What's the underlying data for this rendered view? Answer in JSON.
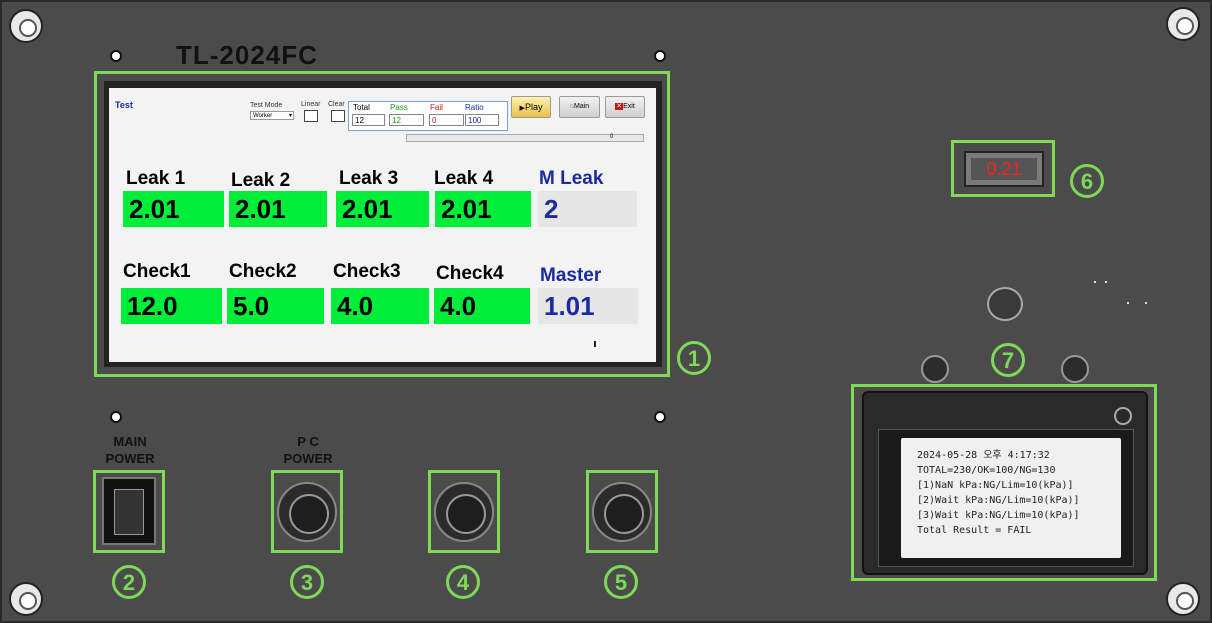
{
  "panel": {
    "model": "TL-2024FC",
    "main_power_label_line1": "MAIN",
    "main_power_label_line2": "POWER",
    "pc_power_label_line1": "P C",
    "pc_power_label_line2": "POWER",
    "display_value": "0.21"
  },
  "callouts": [
    "1",
    "2",
    "3",
    "4",
    "5",
    "6",
    "7"
  ],
  "screen": {
    "title": "Test",
    "test_mode_label": "Test Mode",
    "test_mode_value": "Worker",
    "linear_label": "Linear",
    "clear_label": "Clear",
    "counters": {
      "total_label": "Total",
      "total_value": "12",
      "pass_label": "Pass",
      "pass_value": "12",
      "fail_label": "Fail",
      "fail_value": "0",
      "ratio_label": "Ratio",
      "ratio_value": "100"
    },
    "buttons": {
      "play": "Play",
      "main": "Main",
      "exit": "Exit"
    },
    "progress_value": "0",
    "leaks": [
      {
        "label": "Leak 1",
        "value": "2.01"
      },
      {
        "label": "Leak 2",
        "value": "2.01"
      },
      {
        "label": "Leak 3",
        "value": "2.01"
      },
      {
        "label": "Leak 4",
        "value": "2.01"
      },
      {
        "label": "M Leak",
        "value": "2"
      }
    ],
    "checks": [
      {
        "label": "Check1",
        "value": "12.0"
      },
      {
        "label": "Check2",
        "value": "5.0"
      },
      {
        "label": "Check3",
        "value": "4.0"
      },
      {
        "label": "Check4",
        "value": "4.0"
      },
      {
        "label": "Master",
        "value": "1.01"
      }
    ]
  },
  "receipt": {
    "lines": [
      "2024-05-28 오후 4:17:32",
      "TOTAL=230/OK=100/NG=130",
      "[1)NaN kPa:NG/Lim=10(kPa)]",
      "[2)Wait kPa:NG/Lim=10(kPa)]",
      "[3)Wait kPa:NG/Lim=10(kPa)]",
      "Total Result = FAIL"
    ]
  }
}
